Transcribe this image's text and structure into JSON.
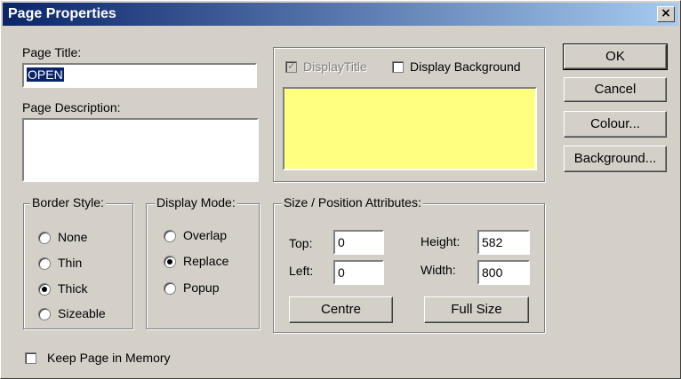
{
  "window": {
    "title": "Page Properties",
    "close_label": "×"
  },
  "page_title": {
    "label": "Page Title:",
    "value": "OPEN"
  },
  "page_description": {
    "label": "Page Description:",
    "value": ""
  },
  "display": {
    "display_title_label": "DisplayTitle",
    "display_title_checked": true,
    "display_title_disabled": true,
    "display_background_label": "Display Background",
    "display_background_checked": false,
    "preview_color": "#ffff80"
  },
  "buttons": {
    "ok": "OK",
    "cancel": "Cancel",
    "colour": "Colour...",
    "background": "Background..."
  },
  "border_style": {
    "legend": "Border Style:",
    "options": [
      "None",
      "Thin",
      "Thick",
      "Sizeable"
    ],
    "selected": "Thick"
  },
  "display_mode": {
    "legend": "Display Mode:",
    "options": [
      "Overlap",
      "Replace",
      "Popup"
    ],
    "selected": "Replace"
  },
  "size_position": {
    "legend": "Size / Position Attributes:",
    "top_label": "Top:",
    "top_value": "0",
    "left_label": "Left:",
    "left_value": "0",
    "height_label": "Height:",
    "height_value": "582",
    "width_label": "Width:",
    "width_value": "800",
    "centre_label": "Centre",
    "full_size_label": "Full Size"
  },
  "keep_in_memory": {
    "label": "Keep Page in Memory",
    "checked": false
  }
}
